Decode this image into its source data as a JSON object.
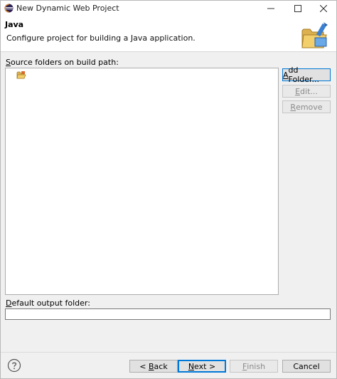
{
  "window": {
    "title": "New Dynamic Web Project",
    "app_icon": "eclipse-icon"
  },
  "header": {
    "title": "Java",
    "description": "Configure project for building a Java application.",
    "icon": "java-folder-wizard-icon"
  },
  "source_folders": {
    "label_underline": "S",
    "label_rest": "ource folders on build path:",
    "items": [
      {
        "icon": "source-folder-icon"
      }
    ]
  },
  "side_buttons": {
    "add_folder": {
      "underline": "A",
      "rest": "dd Folder..."
    },
    "edit": {
      "underline": "E",
      "rest": "dit..."
    },
    "remove": {
      "underline": "R",
      "rest": "emove"
    }
  },
  "output": {
    "label_underline": "D",
    "label_rest": "efault output folder:",
    "value": ""
  },
  "footer": {
    "back": {
      "prefix": "< ",
      "underline": "B",
      "rest": "ack"
    },
    "next": {
      "underline": "N",
      "rest": "ext >"
    },
    "finish": {
      "underline": "F",
      "rest": "inish"
    },
    "cancel": "Cancel"
  },
  "colors": {
    "focus_border": "#0078d7",
    "window_bg": "#f0f0f0"
  }
}
